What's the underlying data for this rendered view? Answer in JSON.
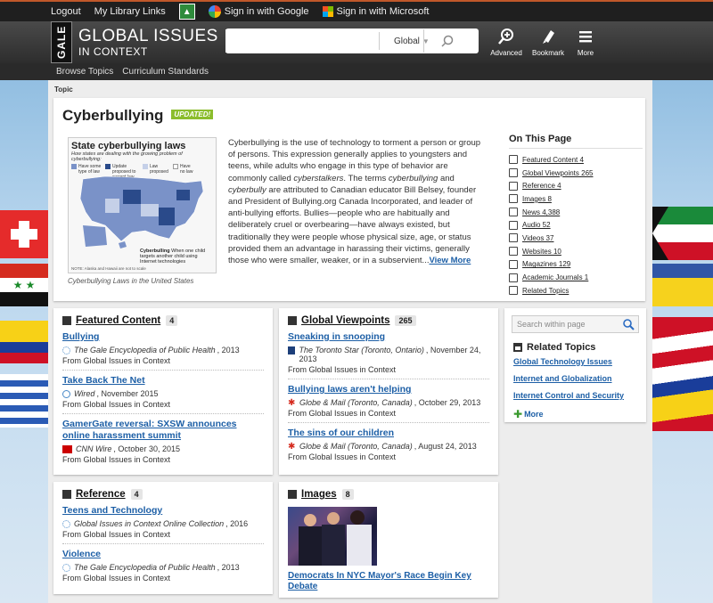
{
  "topbar": {
    "logout": "Logout",
    "my_library": "My Library Links",
    "google_signin": "Sign in with Google",
    "microsoft_signin": "Sign in with Microsoft"
  },
  "header": {
    "logo_gale": "GALE",
    "logo_title": "GLOBAL ISSUES",
    "logo_subtitle": "IN CONTEXT",
    "search_value": "",
    "search_scope": "Global",
    "advanced": "Advanced",
    "bookmark": "Bookmark",
    "more": "More"
  },
  "subnav": {
    "browse": "Browse Topics",
    "curriculum": "Curriculum Standards"
  },
  "breadcrumb": "Topic",
  "topic": {
    "title": "Cyberbullying",
    "badge": "UPDATED!",
    "map_title": "State cyberbullying laws",
    "map_subtitle": "How states are dealing with the growing problem of cyberbullying:",
    "map_legend": [
      "Have some type of law",
      "Update proposed to current law",
      "Law proposed",
      "Have no law"
    ],
    "map_note": "NOTE: Alaska and Hawaii are not to scale",
    "map_callout": "Cyberbulling",
    "map_callout_text": "When one child targets another child using Internet technologies",
    "map_caption": "Cyberbullying Laws in the United States",
    "summary_parts": [
      "Cyberbullying is the use of technology to torment a person or group of persons. This expression generally applies to youngsters and teens, while adults who engage in this type of behavior are commonly called ",
      "cyberstalkers",
      ". The terms ",
      "cyberbullying",
      " and ",
      "cyberbully",
      " are attributed to Canadian educator Bill Belsey, founder and President of Bullying.org Canada Incorporated, and leader of anti-bullying efforts. Bullies—people who are habitually and deliberately cruel or overbearing—have always existed, but traditionally they were people whose physical size, age, or status provided them an advantage in harassing their victims, generally those who were smaller, weaker, or in a subservient..."
    ],
    "view_more": "View More"
  },
  "on_this_page": {
    "heading": "On This Page",
    "items": [
      {
        "label": "Featured Content 4",
        "icon": "star-doc-icon"
      },
      {
        "label": "Global Viewpoints 265",
        "icon": "speech-bubble-icon"
      },
      {
        "label": "Reference 4",
        "icon": "book-icon"
      },
      {
        "label": "Images 8",
        "icon": "image-icon"
      },
      {
        "label": "News 4,388",
        "icon": "newspaper-icon"
      },
      {
        "label": "Audio 52",
        "icon": "speaker-icon"
      },
      {
        "label": "Videos 37",
        "icon": "play-icon"
      },
      {
        "label": "Websites 10",
        "icon": "link-icon"
      },
      {
        "label": "Magazines 129",
        "icon": "magazine-icon"
      },
      {
        "label": "Academic Journals 1",
        "icon": "journal-icon"
      },
      {
        "label": "Related Topics",
        "icon": "hierarchy-icon"
      }
    ]
  },
  "featured": {
    "title": "Featured Content",
    "count": "4",
    "items": [
      {
        "title": "Bullying",
        "source": "The Gale Encyclopedia of Public Health",
        "date": ", 2013",
        "from": "From Global Issues in Context"
      },
      {
        "title": "Take Back The Net",
        "source": "Wired",
        "date": ", November 2015",
        "from": "From Global Issues in Context"
      },
      {
        "title": "GamerGate reversal: SXSW announces online harassment summit",
        "source": "CNN Wire",
        "date": ", October 30, 2015",
        "from": "From Global Issues in Context"
      }
    ]
  },
  "viewpoints": {
    "title": "Global Viewpoints",
    "count": "265",
    "items": [
      {
        "title": "Sneaking in snooping",
        "source": "The Toronto Star (Toronto, Ontario)",
        "date": ", November 24, 2013",
        "from": "From Global Issues in Context"
      },
      {
        "title": "Bullying laws aren't helping",
        "source": "Globe & Mail (Toronto, Canada)",
        "date": ", October 29, 2013",
        "from": "From Global Issues in Context"
      },
      {
        "title": "The sins of our children",
        "source": "Globe & Mail (Toronto, Canada)",
        "date": ", August 24, 2013",
        "from": "From Global Issues in Context"
      }
    ]
  },
  "reference": {
    "title": "Reference",
    "count": "4",
    "items": [
      {
        "title": "Teens and Technology",
        "source": "Global Issues in Context Online Collection",
        "date": ", 2016",
        "from": "From Global Issues in Context"
      },
      {
        "title": "Violence",
        "source": "The Gale Encyclopedia of Public Health",
        "date": ", 2013",
        "from": "From Global Issues in Context"
      }
    ]
  },
  "images": {
    "title": "Images",
    "count": "8",
    "item_title": "Democrats In NYC Mayor's Race Begin Key Debate"
  },
  "sidebar": {
    "search_placeholder": "Search within page",
    "related_heading": "Related Topics",
    "related": [
      "Global Technology Issues",
      "Internet and Globalization",
      "Internet Control and Security"
    ],
    "more": "More"
  },
  "colors": {
    "link": "#1d5fa6",
    "badge": "#8bbd2d",
    "header": "#2d2d2d"
  }
}
